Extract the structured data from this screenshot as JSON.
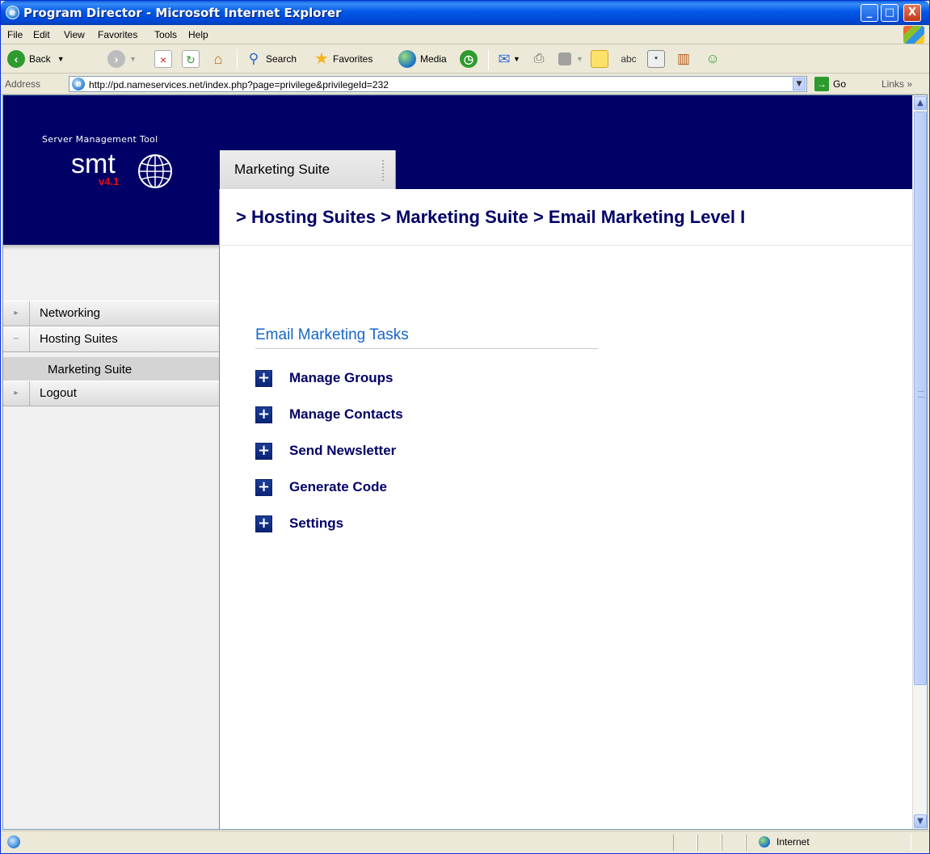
{
  "window": {
    "title": "Program Director - Microsoft Internet Explorer",
    "controls": {
      "minimize": "_",
      "maximize": "□",
      "close": "X"
    }
  },
  "menubar": {
    "items": [
      "File",
      "Edit",
      "View",
      "Favorites",
      "Tools",
      "Help"
    ]
  },
  "toolbar": {
    "back_label": "Back",
    "search_label": "Search",
    "favorites_label": "Favorites",
    "media_label": "Media"
  },
  "addressbar": {
    "label": "Address",
    "url": "http://pd.nameservices.net/index.php?page=privilege&privilegeId=232",
    "go_label": "Go",
    "links_label": "Links"
  },
  "app": {
    "logo_caption": "Server Management Tool",
    "logo_name": "smt",
    "logo_version": "v4.1",
    "active_tab": "Marketing Suite",
    "breadcrumb": "> Hosting Suites > Marketing Suite > Email Marketing Level I"
  },
  "sidebar": {
    "items": [
      {
        "label": "Networking",
        "expander": "▸"
      },
      {
        "label": "Hosting Suites",
        "expander": "−"
      },
      {
        "label": "Marketing Suite"
      },
      {
        "label": "Logout",
        "expander": "▸"
      }
    ]
  },
  "main": {
    "section_title": "Email Marketing Tasks",
    "tasks": [
      {
        "label": "Manage Groups"
      },
      {
        "label": "Manage Contacts"
      },
      {
        "label": "Send Newsletter"
      },
      {
        "label": "Generate Code"
      },
      {
        "label": "Settings"
      }
    ]
  },
  "statusbar": {
    "zone": "Internet"
  },
  "colors": {
    "header_bg": "#000066",
    "breadcrumb": "#000066",
    "section_title": "#1666c9",
    "version_red": "#e0101a"
  }
}
